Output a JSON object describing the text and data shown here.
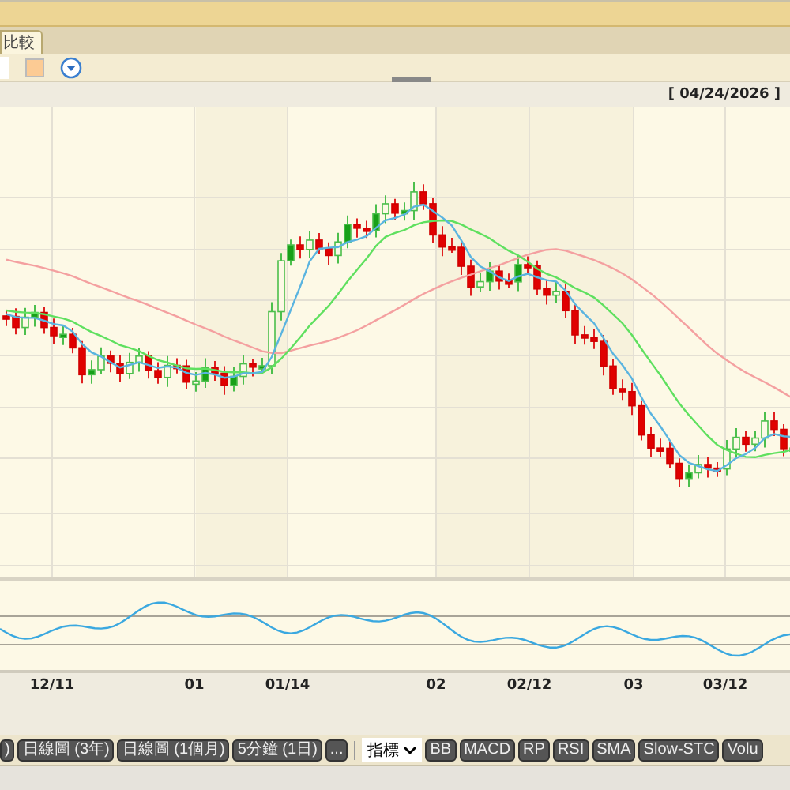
{
  "tabs": [
    {
      "label": "比較",
      "selected": true
    }
  ],
  "date_label": "[ 04/24/2026 ]",
  "x_labels": [
    "12/11",
    "01",
    "01/14",
    "02",
    "02/12",
    "03",
    "03/12"
  ],
  "range_buttons": [
    ")",
    "日線圖 (3年)",
    "日線圖 (1個月)",
    "5分鐘 (1日)",
    "..."
  ],
  "indicator_select": {
    "value": "指標"
  },
  "indicator_buttons": [
    "BB",
    "MACD",
    "RP",
    "RSI",
    "SMA",
    "Slow-STC",
    "Volu"
  ]
}
